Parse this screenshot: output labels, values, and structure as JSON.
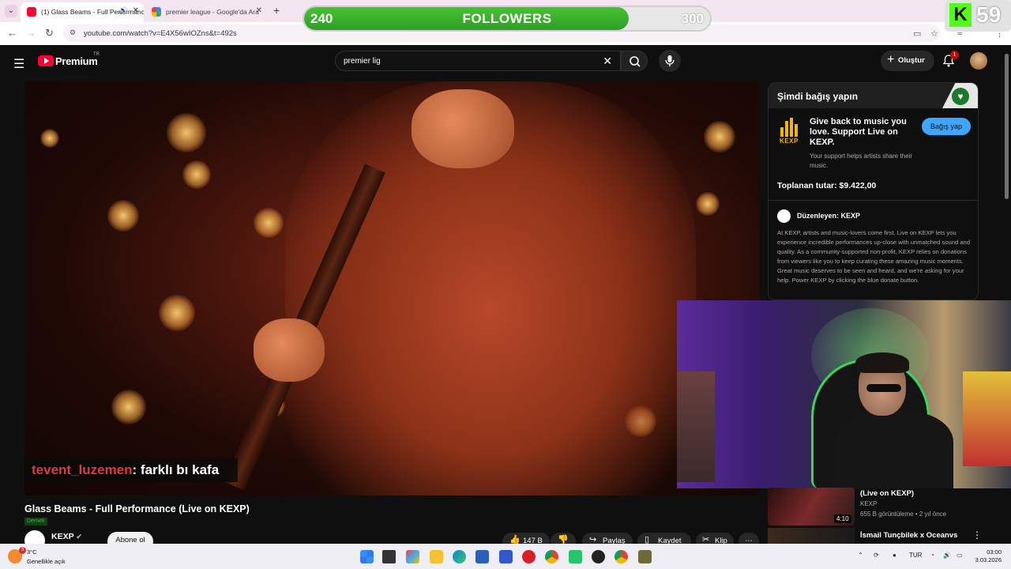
{
  "browser": {
    "tabs": [
      {
        "title": "(1) Glass Beams - Full Performance (Live on KEXP)",
        "active": true
      },
      {
        "title": "premier league - Google'da Ara",
        "active": false
      }
    ],
    "url": "youtube.com/watch?v=E4X56wIOZns&t=492s"
  },
  "overlay": {
    "followers": {
      "label": "FOLLOWERS",
      "current": "240",
      "goal": "300",
      "progress": 0.8
    },
    "kick_count": "59"
  },
  "youtube": {
    "brand": "Premium",
    "region": "TR",
    "search_value": "premier lig",
    "create_label": "Oluştur",
    "notifications": "1"
  },
  "video": {
    "chat_user": "tevent_luzemen",
    "chat_message": ": farklı bı kafa"
  },
  "donation": {
    "header": "Şimdi bağış yapın",
    "logo_text": "KEXP",
    "pitch": "Give back to music you love. Support Live on KEXP.",
    "subtext": "Your support helps artists share their music.",
    "button": "Bağış yap",
    "raised": "Toplanan tutar: $9.422,00",
    "organizer": "Düzenleyen: KEXP",
    "description": "At KEXP, artists and music-lovers come first. Live on KEXP lets you experience incredible performances up-close with unmatched sound and quality. As a community-supported non-profit, KEXP relies on donations from viewers like you to keep curating these amazing music moments. Great music deserves to be seen and heard, and we're asking for your help. Power KEXP by clicking the blue donate button."
  },
  "watch": {
    "title": "Glass Beams - Full Performance (Live on KEXP)",
    "tag": "Dernek",
    "channel": "KEXP",
    "subscribe": "Abone ol",
    "likes": "147 B",
    "share": "Paylaş",
    "save": "Kaydet",
    "clip": "Klip"
  },
  "recommendations": [
    {
      "title": "(Live on KEXP)",
      "channel": "KEXP",
      "meta": "655 B görüntüleme • 2 yıl önce",
      "duration": "4:10"
    },
    {
      "title": "İsmail Tunçbilek x Oceanvs"
    }
  ],
  "taskbar": {
    "weather_temp": "3°C",
    "weather_cond": "Genellikle açık",
    "weather_badge": "3",
    "lang": "TUR",
    "time": "03:00",
    "date": "3.03.2026"
  },
  "colors": {
    "youtube_red": "#ff0033",
    "donate_blue": "#3ea6ff",
    "followers_green": "#47c233",
    "kick_green": "#53fc18",
    "chat_user_red": "#e03a3a"
  }
}
